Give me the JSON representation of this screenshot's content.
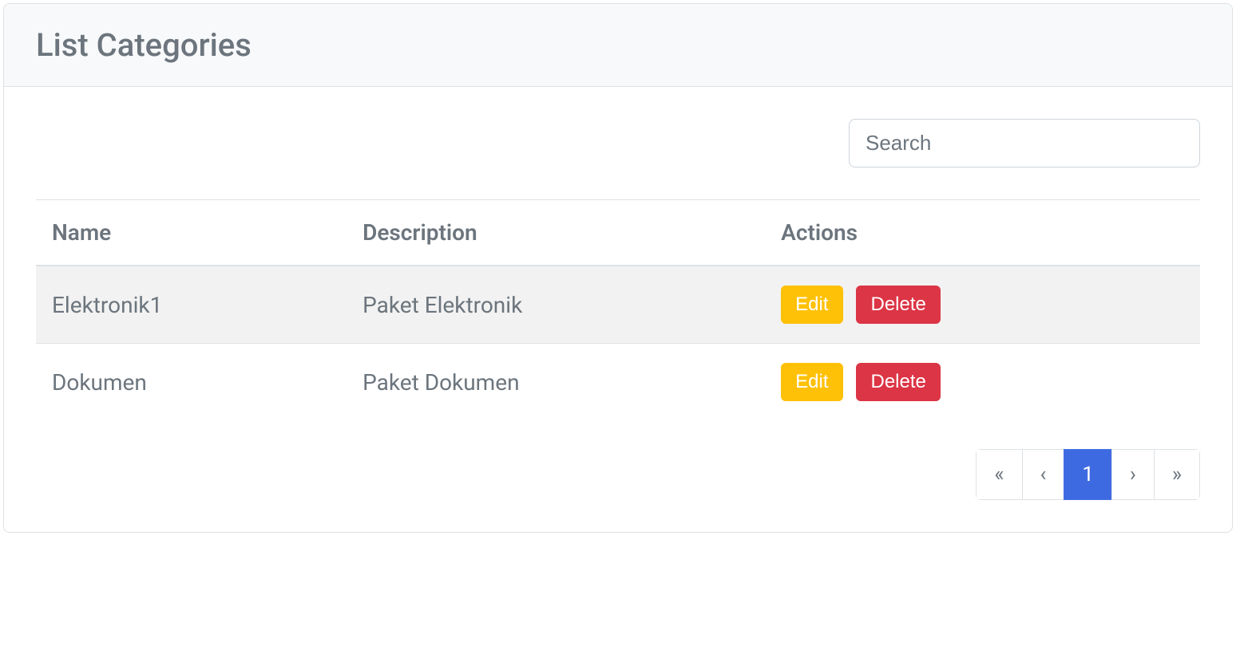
{
  "header": {
    "title": "List Categories"
  },
  "search": {
    "placeholder": "Search",
    "value": ""
  },
  "table": {
    "columns": {
      "name": "Name",
      "description": "Description",
      "actions": "Actions"
    },
    "rows": [
      {
        "name": "Elektronik1",
        "description": "Paket Elektronik"
      },
      {
        "name": "Dokumen",
        "description": "Paket Dokumen"
      }
    ]
  },
  "buttons": {
    "edit": "Edit",
    "delete": "Delete"
  },
  "pagination": {
    "first": "«",
    "prev": "‹",
    "current": "1",
    "next": "›",
    "last": "»"
  }
}
